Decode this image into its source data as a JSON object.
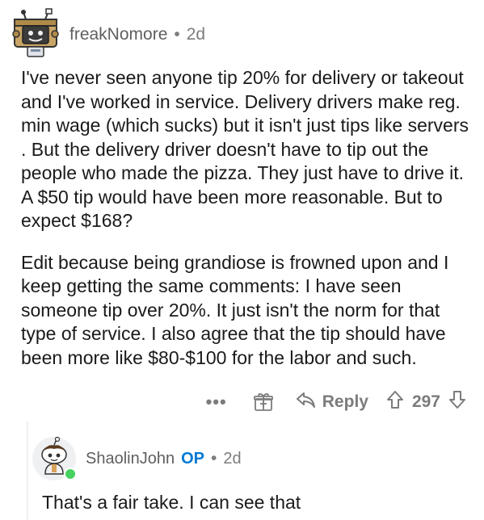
{
  "comment1": {
    "avatar_icon": "snoo-avatar-robot-icon",
    "author": "freakNomore",
    "separator": "•",
    "age": "2d",
    "paragraphs": [
      "I've never seen anyone tip 20% for delivery or takeout and I've worked in service. Delivery drivers make reg. min wage (which sucks) but it isn't just tips like servers . But the delivery driver doesn't have to tip out the people who made the pizza. They just have to drive it. A $50 tip would have been more reasonable. But to expect $168?",
      "Edit because being grandiose is frowned upon and I keep getting the same comments: I have seen someone tip over 20%. It just isn't the norm for that type of service. I also agree that the tip should have been more like $80-$100 for the labor and such."
    ],
    "actions": {
      "more_label": "•••",
      "award_icon": "gift-award-icon",
      "reply_label": "Reply",
      "reply_icon": "reply-arrow-icon",
      "upvote_icon": "upvote-arrow-icon",
      "score": "297",
      "downvote_icon": "downvote-arrow-icon"
    }
  },
  "comment2": {
    "avatar_icon": "snoo-avatar-icon",
    "online_color": "#46d160",
    "author": "ShaolinJohn",
    "op_badge": "OP",
    "separator": "•",
    "age": "2d",
    "text": "That's a fair take. I can see that"
  },
  "colors": {
    "meta_text": "#7c7c7c",
    "body_text": "#1a1a1b",
    "op_blue": "#0079d3",
    "thread_line": "#edeff1"
  }
}
